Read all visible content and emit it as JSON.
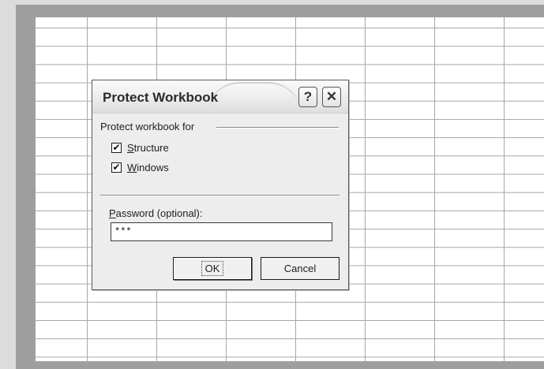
{
  "dialog": {
    "title": "Protect Workbook",
    "help_glyph": "?",
    "close_glyph": "✕",
    "group_label": "Protect workbook for",
    "options": [
      {
        "label_first": "S",
        "label_rest": "tructure",
        "checked": true
      },
      {
        "label_first": "W",
        "label_rest": "indows",
        "checked": true
      }
    ],
    "password_label_first": "P",
    "password_label_rest": "assword (optional):",
    "password_value": "***",
    "ok_label": "OK",
    "cancel_label": "Cancel",
    "check_glyph": "✔"
  }
}
